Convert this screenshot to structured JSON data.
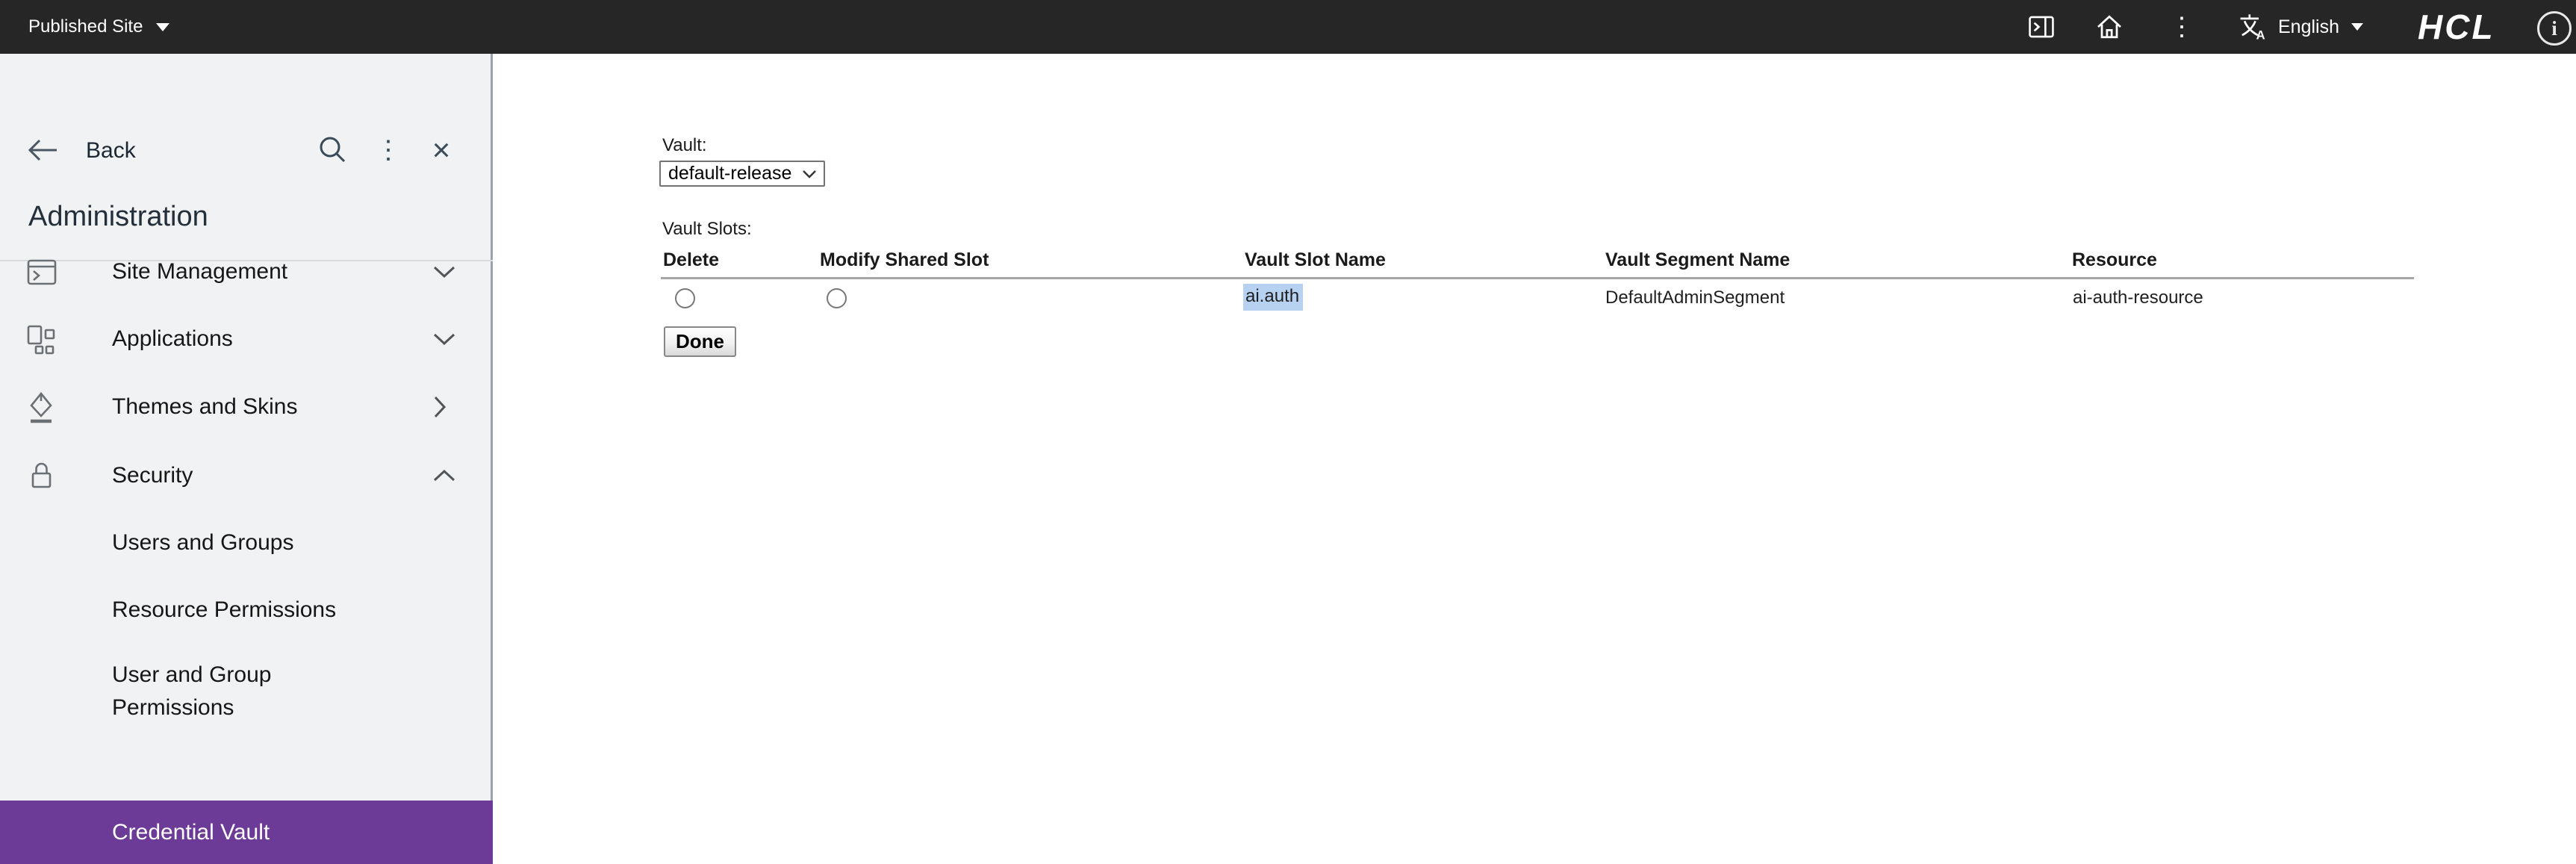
{
  "topbar": {
    "site_menu_label": "Published Site",
    "language_label": "English",
    "logo_text": "HCL",
    "info_glyph": "i",
    "kebab_glyph": "⋮",
    "background_color": "#262626"
  },
  "sidebar": {
    "back_label": "Back",
    "kebab_glyph": "⋮",
    "close_glyph": "×",
    "title": "Administration",
    "menu": [
      {
        "label": "Site Management",
        "chevron": "down"
      },
      {
        "label": "Applications",
        "chevron": "down"
      },
      {
        "label": "Themes and Skins",
        "chevron": "right"
      },
      {
        "label": "Security",
        "chevron": "up"
      }
    ],
    "security_items": [
      {
        "label": "Users and Groups"
      },
      {
        "label": "Resource Permissions"
      },
      {
        "label": "User and Group Permissions"
      },
      {
        "label": "Credential Vault",
        "selected": true
      }
    ],
    "selected_color": "#6c3a97",
    "background_color": "#f1f2f4"
  },
  "main": {
    "vault_label": "Vault:",
    "vault_select_value": "default-release",
    "vault_slots_label": "Vault Slots:",
    "table": {
      "headers": [
        "Delete",
        "Modify Shared Slot",
        "Vault Slot Name",
        "Vault Segment Name",
        "Resource"
      ],
      "rows": [
        {
          "vault_slot_name": "ai.auth",
          "vault_segment_name": "DefaultAdminSegment",
          "resource": "ai-auth-resource",
          "slot_name_highlight_color": "#b7d2f1"
        }
      ]
    },
    "done_label": "Done"
  }
}
